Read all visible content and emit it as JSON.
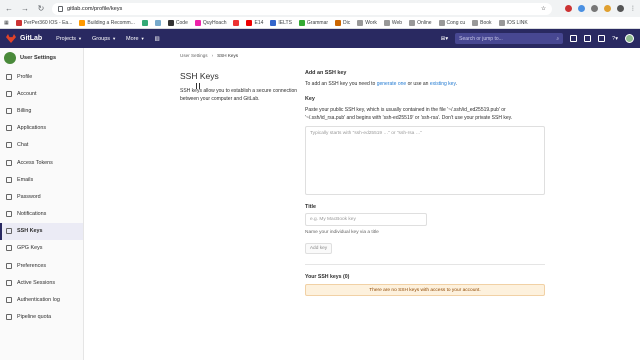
{
  "browser": {
    "url": "gitlab.com/profile/keys",
    "bookmarks": [
      "PerPer360 IOS - Ea...",
      "Building a Recomm...",
      "Code",
      "QuyHoach",
      "E14",
      "IELTS",
      "Grammar",
      "Dic",
      "Work",
      "Web",
      "Online",
      "Cong cu",
      "Book",
      "IOS LINK"
    ]
  },
  "header": {
    "brand": "GitLab",
    "menu": [
      "Projects",
      "Groups",
      "More"
    ],
    "search_placeholder": "Search or jump to..."
  },
  "sidebar": {
    "title": "User Settings",
    "items": [
      {
        "label": "Profile"
      },
      {
        "label": "Account"
      },
      {
        "label": "Billing"
      },
      {
        "label": "Applications"
      },
      {
        "label": "Chat"
      },
      {
        "label": "Access Tokens"
      },
      {
        "label": "Emails"
      },
      {
        "label": "Password"
      },
      {
        "label": "Notifications"
      },
      {
        "label": "SSH Keys"
      },
      {
        "label": "GPG Keys"
      },
      {
        "label": "Preferences"
      },
      {
        "label": "Active Sessions"
      },
      {
        "label": "Authentication log"
      },
      {
        "label": "Pipeline quota"
      }
    ],
    "active_index": 9
  },
  "breadcrumb": [
    "User Settings",
    "SSH Keys"
  ],
  "page": {
    "title": "SSH Keys",
    "description": "SSH keys allow you to establish a secure connection between your computer and GitLab."
  },
  "form": {
    "heading": "Add an SSH key",
    "intro_prefix": "To add an SSH key you need to",
    "intro_link1": "generate one",
    "intro_mid": "or use an",
    "intro_link2": "existing key",
    "key_label": "Key",
    "key_help": "Paste your public SSH key, which is usually contained in the file '~/.ssh/id_ed25519.pub' or '~/.ssh/id_rsa.pub' and begins with 'ssh-ed25519' or 'ssh-rsa'. Don't use your private SSH key.",
    "key_placeholder": "Typically starts with \"ssh-ed25519 …\" or \"ssh-rsa …\"",
    "title_label": "Title",
    "title_placeholder": "e.g. My MacBook key",
    "title_help": "Name your individual key via a title",
    "add_button": "Add key"
  },
  "keys": {
    "heading": "Your SSH keys (0)",
    "empty_message": "There are no SSH keys with access to your account."
  },
  "colors": {
    "header_bg": "#292961",
    "link": "#1f78d1",
    "warning_bg": "#fdf1dd"
  }
}
